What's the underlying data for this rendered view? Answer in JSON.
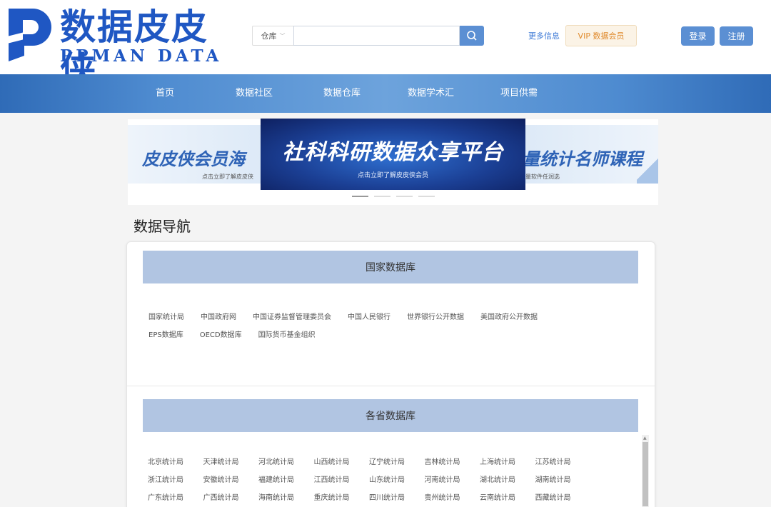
{
  "logo": {
    "title": "数据皮皮侠",
    "subtitle": "PPMAN DATA"
  },
  "search": {
    "category": "仓库",
    "placeholder": ""
  },
  "header_links": {
    "more_info": "更多信息",
    "vip": "VIP 数据会员",
    "login": "登录",
    "register": "注册"
  },
  "nav": [
    "首页",
    "数据社区",
    "数据仓库",
    "数据学术汇",
    "项目供需"
  ],
  "banner": {
    "left_title": "皮皮侠会员海",
    "left_sub": "点击立即了解皮皮侠",
    "main_title": "社科科研数据众享平台",
    "main_sub": "点击立即了解皮皮侠会员",
    "right_title": "量统计名师课程",
    "right_sub": "量软件任润选"
  },
  "section_title": "数据导航",
  "national": {
    "header": "国家数据库",
    "row1": [
      "国家统计局",
      "中国政府网",
      "中国证券监督管理委员会",
      "中国人民银行",
      "世界银行公开数据",
      "美国政府公开数据"
    ],
    "row2": [
      "EPS数据库",
      "OECD数据库",
      "国际货币基金组织"
    ]
  },
  "provincial": {
    "header": "各省数据库",
    "items": [
      "北京统计局",
      "天津统计局",
      "河北统计局",
      "山西统计局",
      "辽宁统计局",
      "吉林统计局",
      "上海统计局",
      "江苏统计局",
      "浙江统计局",
      "安徽统计局",
      "福建统计局",
      "江西统计局",
      "山东统计局",
      "河南统计局",
      "湖北统计局",
      "湖南统计局",
      "广东统计局",
      "广西统计局",
      "海南统计局",
      "重庆统计局",
      "四川统计局",
      "贵州统计局",
      "云南统计局",
      "西藏统计局"
    ]
  },
  "colors": {
    "brand": "#1f57c3",
    "button": "#5b8fd3",
    "group_header": "#b1c5e2",
    "vip_text": "#e08a2c"
  }
}
